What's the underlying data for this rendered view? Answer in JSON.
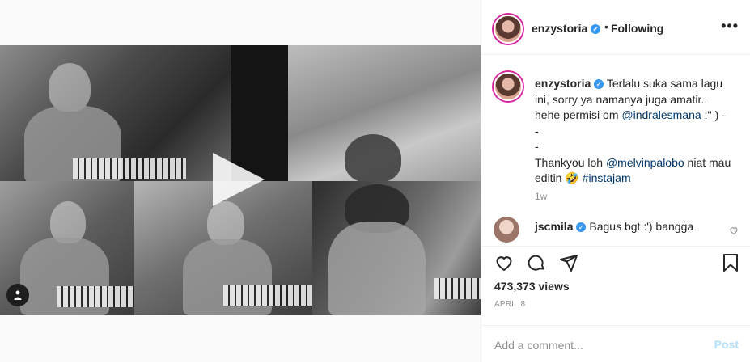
{
  "post": {
    "username": "enzystoria",
    "separator": "•",
    "follow_label": "Following",
    "more_label": "•••"
  },
  "caption": {
    "username": "enzystoria",
    "text_part1": "Terlalu suka sama lagu ini, sorry ya namanya juga amatir.. hehe permisi om ",
    "mention1": "@indralesmana",
    "text_part2": " :'' ) -",
    "line_dash1": "-",
    "line_dash2": "-",
    "text_part3": "Thankyou loh ",
    "mention2": "@melvinpalobo",
    "text_part4": " niat mau editin ",
    "emoji": "🤣",
    "hashtag": "#instajam",
    "time": "1w"
  },
  "comment": {
    "username": "jscmila",
    "text": "Bagus bgt :') bangga"
  },
  "stats": {
    "views": "473,373 views",
    "date": "APRIL 8"
  },
  "add_comment": {
    "placeholder": "Add a comment...",
    "post_label": "Post"
  },
  "icons": {
    "like": "heart-icon",
    "comment": "comment-icon",
    "share": "share-icon",
    "save": "bookmark-icon",
    "sound": "speaker-icon",
    "play": "play-icon",
    "verified": "verified-badge-icon"
  },
  "colors": {
    "verified": "#3897f0",
    "post_disabled": "#b2dffc",
    "mention": "#00376b",
    "muted": "#8e8e8e"
  }
}
